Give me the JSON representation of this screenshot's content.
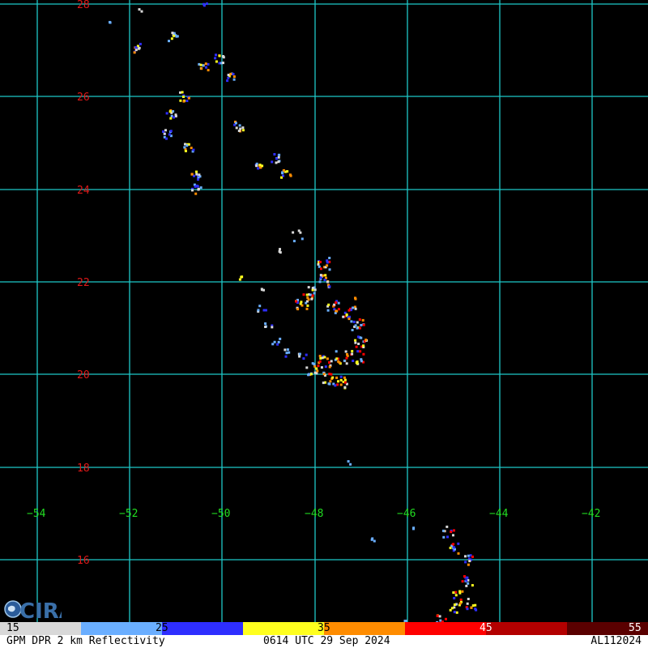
{
  "map": {
    "latitudes": [
      "28",
      "26",
      "24",
      "22",
      "20",
      "18",
      "16"
    ],
    "longitudes": [
      "−54",
      "−52",
      "−50",
      "−48",
      "−46",
      "−44",
      "−42"
    ],
    "colors": {
      "grid": "#1ec8c8",
      "lat_label": "#e01818",
      "lon_label": "#22dd22",
      "background": "#000000"
    }
  },
  "colorbar": {
    "ticks": [
      "15",
      "25",
      "35",
      "45",
      "55"
    ],
    "colors": [
      "#d8d8d8",
      "#6aaeff",
      "#2e2eff",
      "#ffff1e",
      "#ff8c00",
      "#ff0000",
      "#b30000",
      "#5a0000"
    ]
  },
  "footer": {
    "product": "GPM DPR 2 km Reflectivity",
    "time": "0614 UTC 29 Sep 2024",
    "storm_id": "AL112024"
  },
  "logo": {
    "text": "CIRA",
    "icon": "earth-globe-icon"
  }
}
